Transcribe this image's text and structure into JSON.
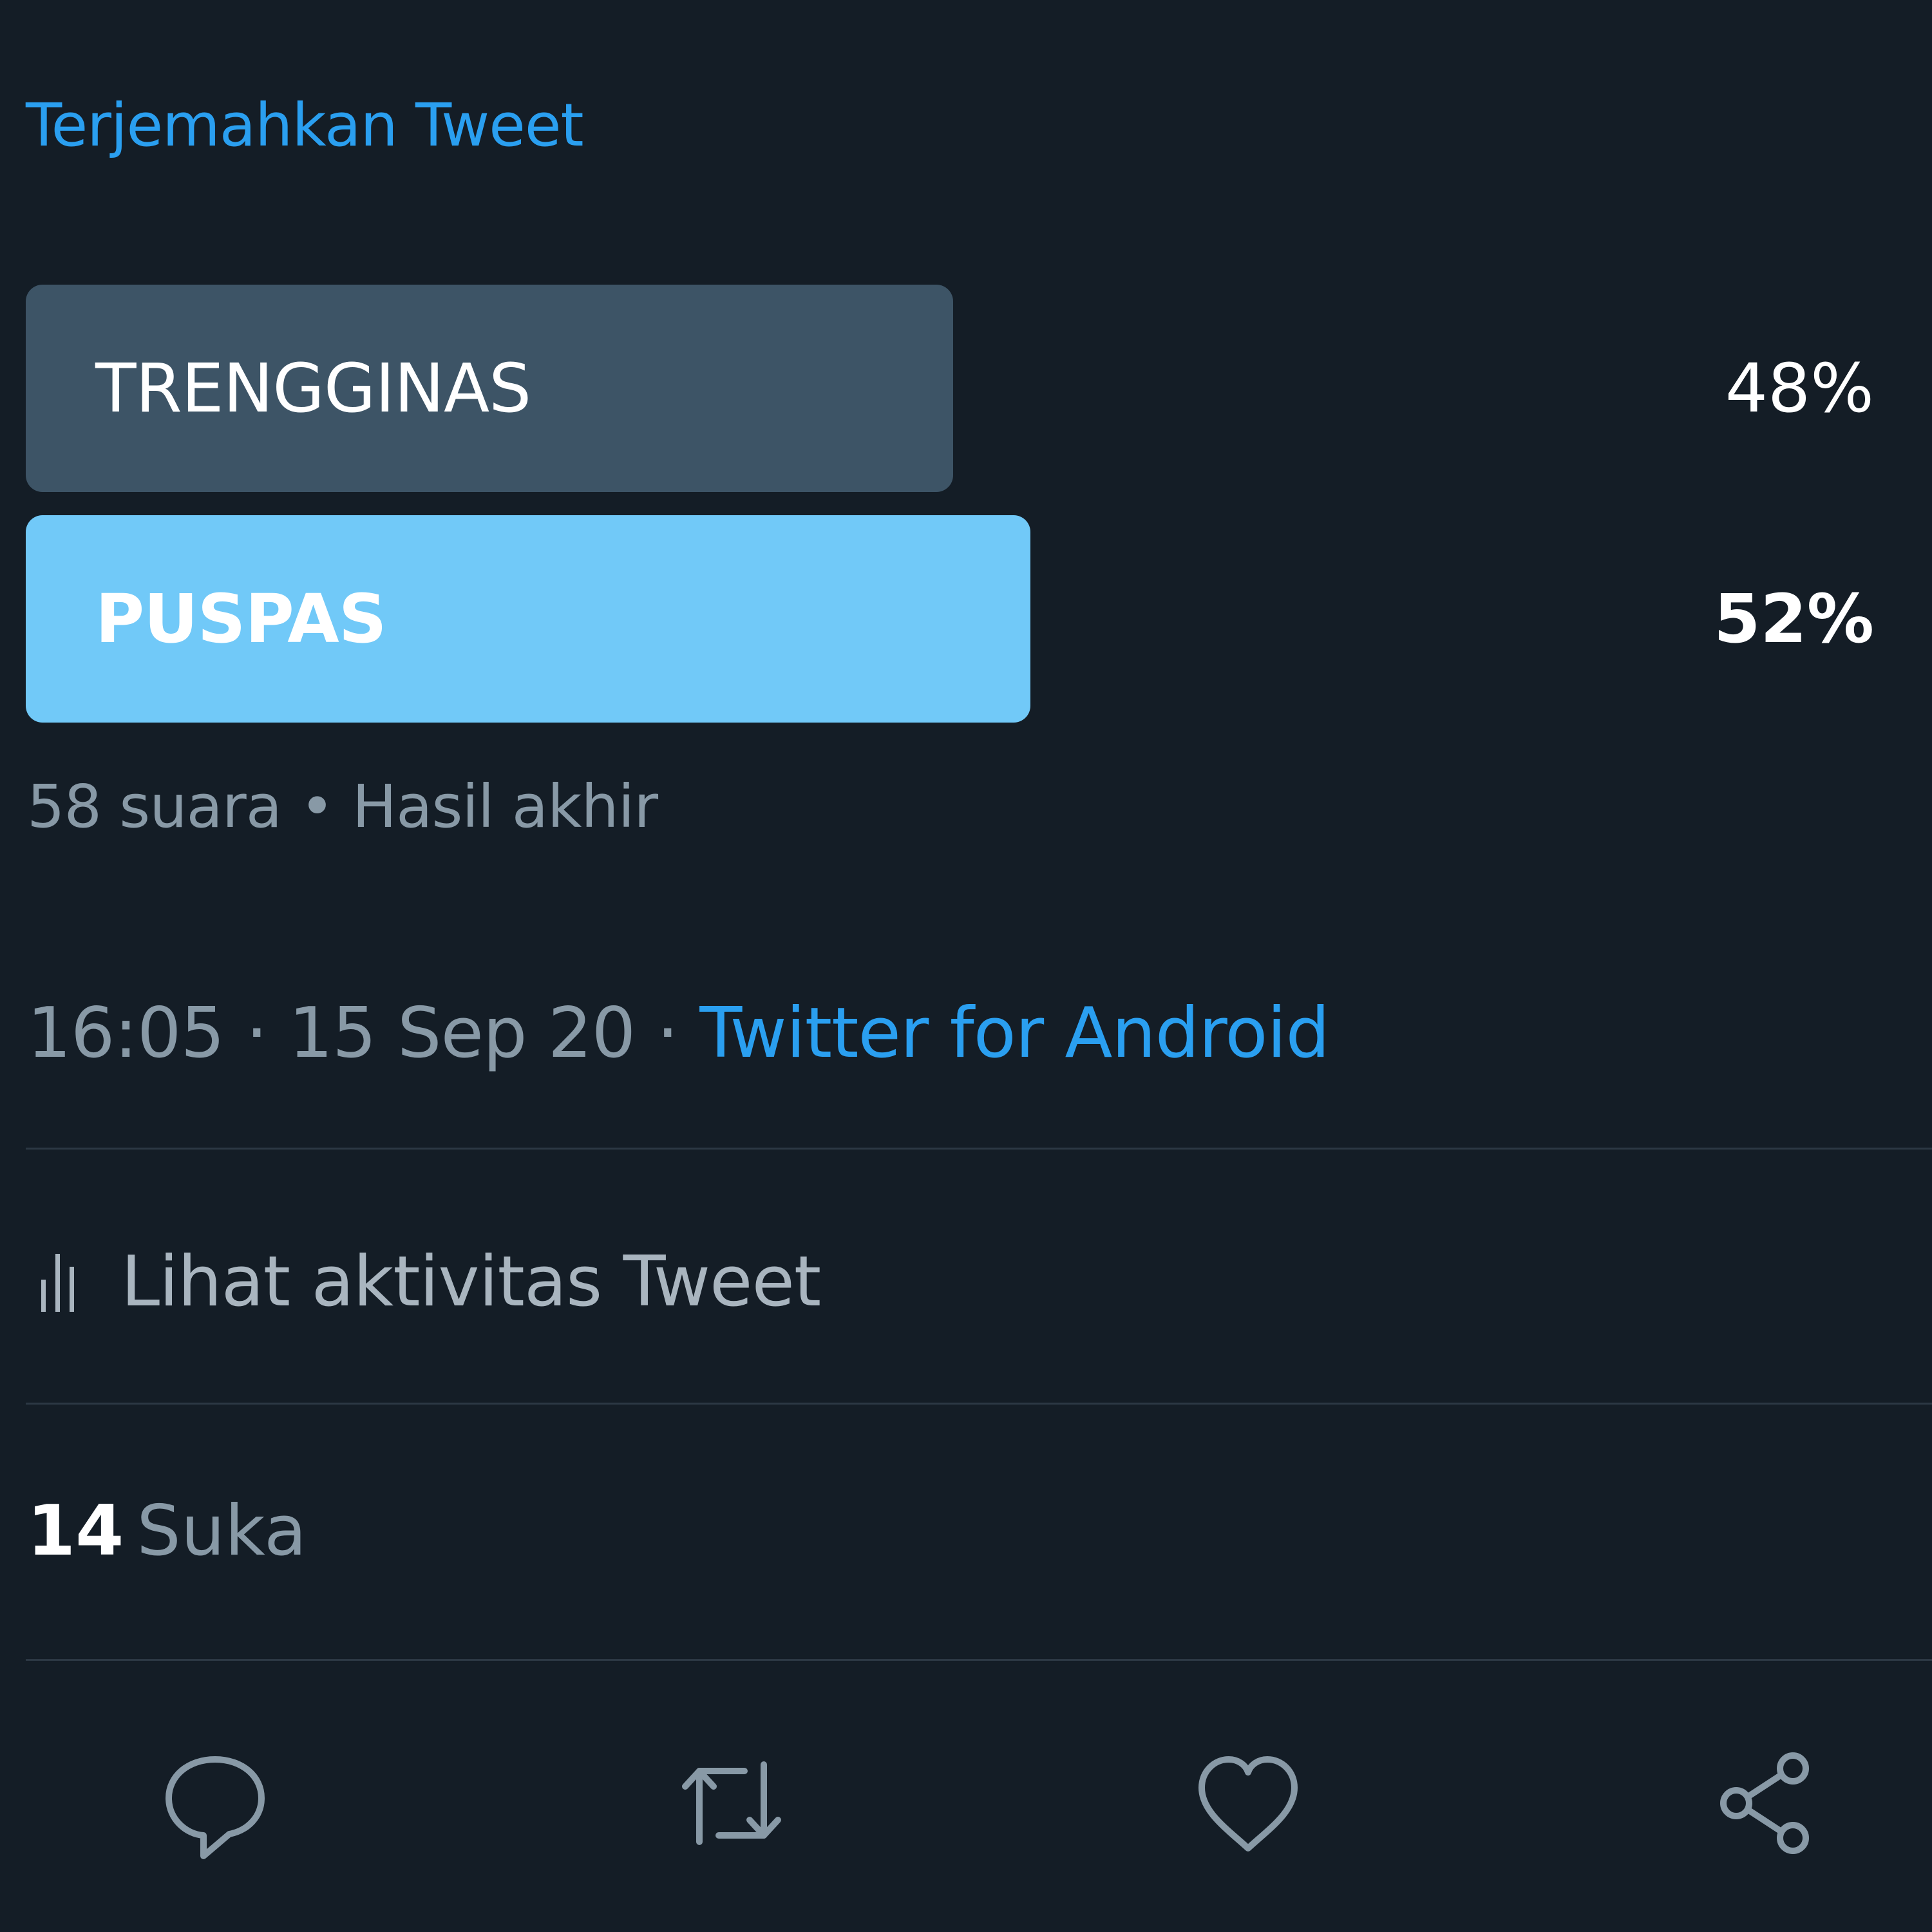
{
  "tweet": {
    "translate_link": "Terjemahkan Tweet",
    "poll": {
      "options": [
        {
          "label": "TRENGGINAS",
          "percent_text": "48%",
          "percent": 48,
          "winner": false
        },
        {
          "label": "PUSPAS",
          "percent_text": "52%",
          "percent": 52,
          "winner": true
        }
      ],
      "summary": "58 suara • Hasil akhir"
    },
    "meta": {
      "time": "16:05",
      "separator": " · ",
      "date": "15 Sep 20",
      "source": "Twitter for Android"
    },
    "activity_label": "Lihat aktivitas Tweet",
    "likes": {
      "count": "14",
      "label": "Suka"
    }
  },
  "actions": {
    "reply_icon": "reply-icon",
    "retweet_icon": "retweet-icon",
    "like_icon": "heart-icon",
    "share_icon": "share-icon"
  },
  "colors": {
    "background": "#141d26",
    "accent": "#2a9ff0",
    "poll_loser": "#3d5466",
    "poll_winner": "#71c9f8",
    "muted_text": "#8899a6"
  }
}
